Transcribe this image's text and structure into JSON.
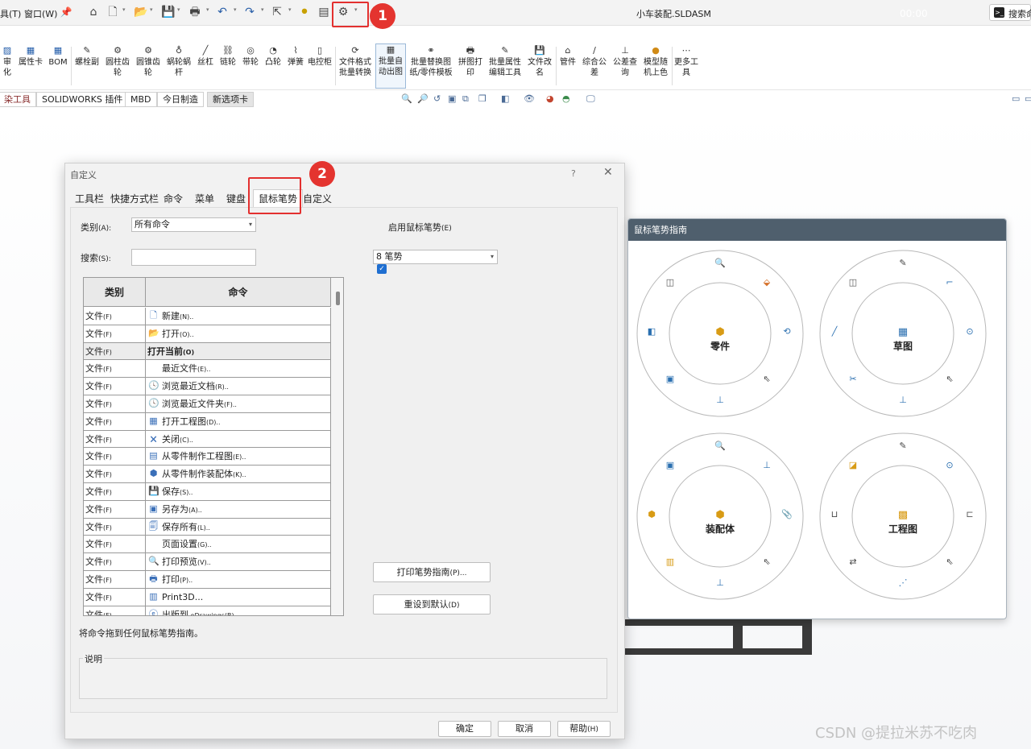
{
  "titlebar": {
    "menu_tools": "具(T)",
    "menu_window": "窗口(W)",
    "document_title": "小车装配.SLDASM",
    "timer": "00:00",
    "search_label": "搜索命"
  },
  "annotations": {
    "badge_1": "1",
    "badge_2": "2"
  },
  "ribbon": {
    "items": [
      {
        "label1": "审",
        "label2": "化"
      },
      {
        "label1": "属性卡",
        "label2": ""
      },
      {
        "label1": "BOM",
        "label2": ""
      },
      {
        "label1": "螺栓副",
        "label2": ""
      },
      {
        "label1": "圆柱齿",
        "label2": "轮"
      },
      {
        "label1": "圆锥齿",
        "label2": "轮"
      },
      {
        "label1": "蜗轮蜗",
        "label2": "杆"
      },
      {
        "label1": "丝杠",
        "label2": ""
      },
      {
        "label1": "链轮",
        "label2": ""
      },
      {
        "label1": "带轮",
        "label2": ""
      },
      {
        "label1": "凸轮",
        "label2": ""
      },
      {
        "label1": "弹簧",
        "label2": ""
      },
      {
        "label1": "电控柜",
        "label2": ""
      },
      {
        "label1": "文件格式",
        "label2": "批量转换"
      },
      {
        "label1": "批量自",
        "label2": "动出图"
      },
      {
        "label1": "批量替换图",
        "label2": "纸/零件模板"
      },
      {
        "label1": "拼图打",
        "label2": "印"
      },
      {
        "label1": "批量属性",
        "label2": "编辑工具"
      },
      {
        "label1": "文件改",
        "label2": "名"
      },
      {
        "label1": "管件",
        "label2": ""
      },
      {
        "label1": "综合公",
        "label2": "差"
      },
      {
        "label1": "公差查",
        "label2": "询"
      },
      {
        "label1": "模型随",
        "label2": "机上色"
      },
      {
        "label1": "更多工",
        "label2": "具"
      }
    ]
  },
  "command_tabs": [
    "染工具",
    "SOLIDWORKS 插件",
    "MBD",
    "今日制造",
    "新选项卡"
  ],
  "dialog": {
    "title": "自定义",
    "help": "?",
    "close": "✕",
    "tabs": [
      "工具栏",
      "快捷方式栏",
      "命令",
      "菜单",
      "键盘",
      "鼠标笔势",
      "自定义"
    ],
    "category_label": "类别",
    "category_key": "(A):",
    "category_value": "所有命令",
    "search_label": "搜索",
    "search_key": "(S):",
    "search_value": "",
    "enable_label": "启用鼠标笔势",
    "enable_key": "(E)",
    "gesture_count": "8 笔势",
    "table": {
      "col_category": "类别",
      "col_command": "命令",
      "rows": [
        {
          "cat": "文件",
          "key": "(F)",
          "cmd": "新建",
          "ckey": "(N)..",
          "icon": "🗋",
          "bold": false
        },
        {
          "cat": "文件",
          "key": "(F)",
          "cmd": "打开",
          "ckey": "(O)..",
          "icon": "📂",
          "bold": false
        },
        {
          "cat": "文件",
          "key": "(F)",
          "cmd": "打开当前",
          "ckey": "(O)",
          "icon": "",
          "bold": true
        },
        {
          "cat": "文件",
          "key": "(F)",
          "cmd": "最近文件",
          "ckey": "(E)..",
          "icon": "",
          "bold": false
        },
        {
          "cat": "文件",
          "key": "(F)",
          "cmd": "浏览最近文档",
          "ckey": "(R)..",
          "icon": "🕓",
          "bold": false
        },
        {
          "cat": "文件",
          "key": "(F)",
          "cmd": "浏览最近文件夹",
          "ckey": "(F)..",
          "icon": "🕓",
          "bold": false
        },
        {
          "cat": "文件",
          "key": "(F)",
          "cmd": "打开工程图",
          "ckey": "(D)..",
          "icon": "▦",
          "bold": false
        },
        {
          "cat": "文件",
          "key": "(F)",
          "cmd": "关闭",
          "ckey": "(C)..",
          "icon": "🗙",
          "bold": false
        },
        {
          "cat": "文件",
          "key": "(F)",
          "cmd": "从零件制作工程图",
          "ckey": "(E)..",
          "icon": "▤",
          "bold": false
        },
        {
          "cat": "文件",
          "key": "(F)",
          "cmd": "从零件制作装配体",
          "ckey": "(K)..",
          "icon": "⬢",
          "bold": false
        },
        {
          "cat": "文件",
          "key": "(F)",
          "cmd": "保存",
          "ckey": "(S)..",
          "icon": "💾",
          "bold": false
        },
        {
          "cat": "文件",
          "key": "(F)",
          "cmd": "另存为",
          "ckey": "(A)..",
          "icon": "▣",
          "bold": false
        },
        {
          "cat": "文件",
          "key": "(F)",
          "cmd": "保存所有",
          "ckey": "(L)..",
          "icon": "🗐",
          "bold": false
        },
        {
          "cat": "文件",
          "key": "(F)",
          "cmd": "页面设置",
          "ckey": "(G)..",
          "icon": "",
          "bold": false
        },
        {
          "cat": "文件",
          "key": "(F)",
          "cmd": "打印预览",
          "ckey": "(V)..",
          "icon": "🔍",
          "bold": false
        },
        {
          "cat": "文件",
          "key": "(F)",
          "cmd": "打印",
          "ckey": "(P)..",
          "icon": "🖶",
          "bold": false
        },
        {
          "cat": "文件",
          "key": "(F)",
          "cmd": "Print3D...",
          "ckey": "",
          "icon": "▥",
          "bold": false
        },
        {
          "cat": "文件",
          "key": "(F)",
          "cmd": "出版到",
          "ckey": " eDrawings(B)..",
          "icon": "ⓔ",
          "bold": false
        }
      ]
    },
    "print_button": "打印笔势指南",
    "print_key": "(P)...",
    "reset_button": "重设到默认",
    "reset_key": "(D)",
    "drag_hint": "将命令拖到任何鼠标笔势指南。",
    "description_label": "说明",
    "ok": "确定",
    "cancel": "取消",
    "help_button": "帮助",
    "help_key": "(H)"
  },
  "guide": {
    "title": "鼠标笔势指南",
    "wheels": [
      {
        "label": "零件"
      },
      {
        "label": "草图"
      },
      {
        "label": "装配体"
      },
      {
        "label": "工程图"
      }
    ]
  },
  "watermark": "CSDN @提拉米苏不吃肉"
}
